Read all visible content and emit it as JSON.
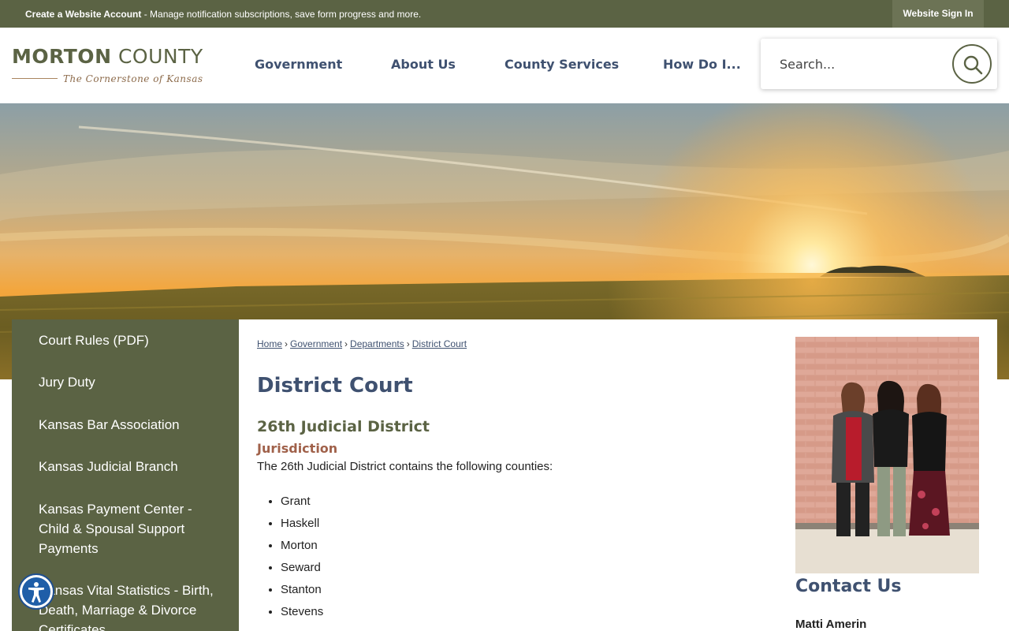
{
  "topbar": {
    "account_label": "Create a Website Account",
    "account_desc": " - Manage notification subscriptions, save form progress and more.",
    "signin_label": "Website Sign In"
  },
  "logo": {
    "title_bold": "MORTON",
    "title_rest": " COUNTY",
    "tagline": "The Cornerstone of Kansas"
  },
  "nav": {
    "items": [
      "Government",
      "About Us",
      "County Services",
      "How Do I..."
    ]
  },
  "search": {
    "placeholder": "Search...",
    "icon": "search-icon"
  },
  "sidebar": {
    "items": [
      "Court Rules (PDF)",
      "Jury Duty",
      "Kansas Bar Association",
      "Kansas Judicial Branch",
      "Kansas Payment Center - Child & Spousal Support Payments",
      "Kansas Vital Statistics - Birth, Death, Marriage & Divorce Certificates"
    ]
  },
  "breadcrumb": {
    "items": [
      "Home",
      "Government",
      "Departments",
      "District Court"
    ],
    "separator": "›"
  },
  "main": {
    "title": "District Court",
    "subtitle": "26th Judicial District",
    "section": "Jurisdiction",
    "intro": "The 26th Judicial District contains the following counties:",
    "counties": [
      "Grant",
      "Haskell",
      "Morton",
      "Seward",
      "Stanton",
      "Stevens"
    ]
  },
  "contact": {
    "title": "Contact Us",
    "name": "Matti Amerin"
  },
  "colors": {
    "olive": "#5b6344",
    "navy": "#3f5170",
    "rust": "#a0614a"
  }
}
